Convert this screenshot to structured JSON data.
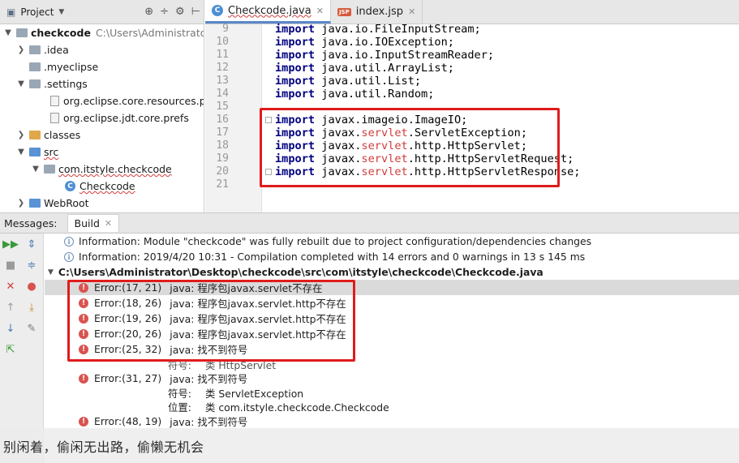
{
  "project_panel": {
    "title": "Project",
    "tree": [
      {
        "label": "checkcode",
        "path": "C:\\Users\\Administrator\\D"
      },
      {
        "label": ".idea"
      },
      {
        "label": ".myeclipse"
      },
      {
        "label": ".settings"
      },
      {
        "label": "org.eclipse.core.resources.pre"
      },
      {
        "label": "org.eclipse.jdt.core.prefs"
      },
      {
        "label": "classes"
      },
      {
        "label": "src"
      },
      {
        "label": "com.itstyle.checkcode"
      },
      {
        "label": "Checkcode"
      },
      {
        "label": "WebRoot"
      }
    ]
  },
  "editor": {
    "tabs": [
      {
        "label": "Checkcode.java",
        "icon": "C"
      },
      {
        "label": "index.jsp",
        "icon": "JSP"
      }
    ],
    "line_numbers": [
      "9",
      "10",
      "11",
      "12",
      "13",
      "14",
      "15",
      "16",
      "17",
      "18",
      "19",
      "20",
      "21"
    ],
    "code": {
      "kw": "import",
      "l9": "java.io.FileInputStream;",
      "l10": "java.io.IOException;",
      "l11": "java.io.InputStreamReader;",
      "l12": "java.util.ArrayList;",
      "l13": "java.util.List;",
      "l14": "java.util.Random;",
      "l16": "javax.imageio.ImageIO;",
      "l17a": "javax.",
      "l17b": "servlet",
      "l17c": ".ServletException;",
      "l18a": "javax.",
      "l18b": "servlet",
      "l18c": ".http.HttpServlet;",
      "l19a": "javax.",
      "l19b": "servlet",
      "l19c": ".http.HttpServletRequest;",
      "l20a": "javax.",
      "l20b": "servlet",
      "l20c": ".http.HttpServletResponse;"
    }
  },
  "bottom_tabs": {
    "messages_label": "Messages:",
    "build_label": "Build"
  },
  "messages": {
    "info1": "Information: Module \"checkcode\" was fully rebuilt due to project configuration/dependencies changes",
    "info2": "Information: 2019/4/20 10:31 - Compilation completed with 14 errors and 0 warnings in 13 s 145 ms",
    "file_path": "C:\\Users\\Administrator\\Desktop\\checkcode\\src\\com\\itstyle\\checkcode\\Checkcode.java",
    "errors": [
      {
        "loc": "Error:(17, 21)",
        "text": "java: 程序包javax.servlet不存在"
      },
      {
        "loc": "Error:(18, 26)",
        "text": "java: 程序包javax.servlet.http不存在"
      },
      {
        "loc": "Error:(19, 26)",
        "text": "java: 程序包javax.servlet.http不存在"
      },
      {
        "loc": "Error:(20, 26)",
        "text": "java: 程序包javax.servlet.http不存在"
      },
      {
        "loc": "Error:(25, 32)",
        "text": "java: 找不到符号"
      },
      {
        "loc": "Error:(31, 27)",
        "text": "java: 找不到符号"
      },
      {
        "loc": "Error:(48, 19)",
        "text": "java: 找不到符号"
      }
    ],
    "detail_25": {
      "k": "符号:",
      "v": "类 HttpServlet"
    },
    "detail_31a": {
      "k": "符号:",
      "v": "类 ServletException"
    },
    "detail_31b": {
      "k": "位置:",
      "v": "类 com.itstyle.checkcode.Checkcode"
    }
  },
  "watermark": "别闲着，偷闲无出路，偷懒无机会",
  "colors": {
    "keyword": "#000080",
    "error_text": "#d23b3b",
    "highlight_box": "#e01b1b",
    "error_icon": "#d9534f"
  }
}
